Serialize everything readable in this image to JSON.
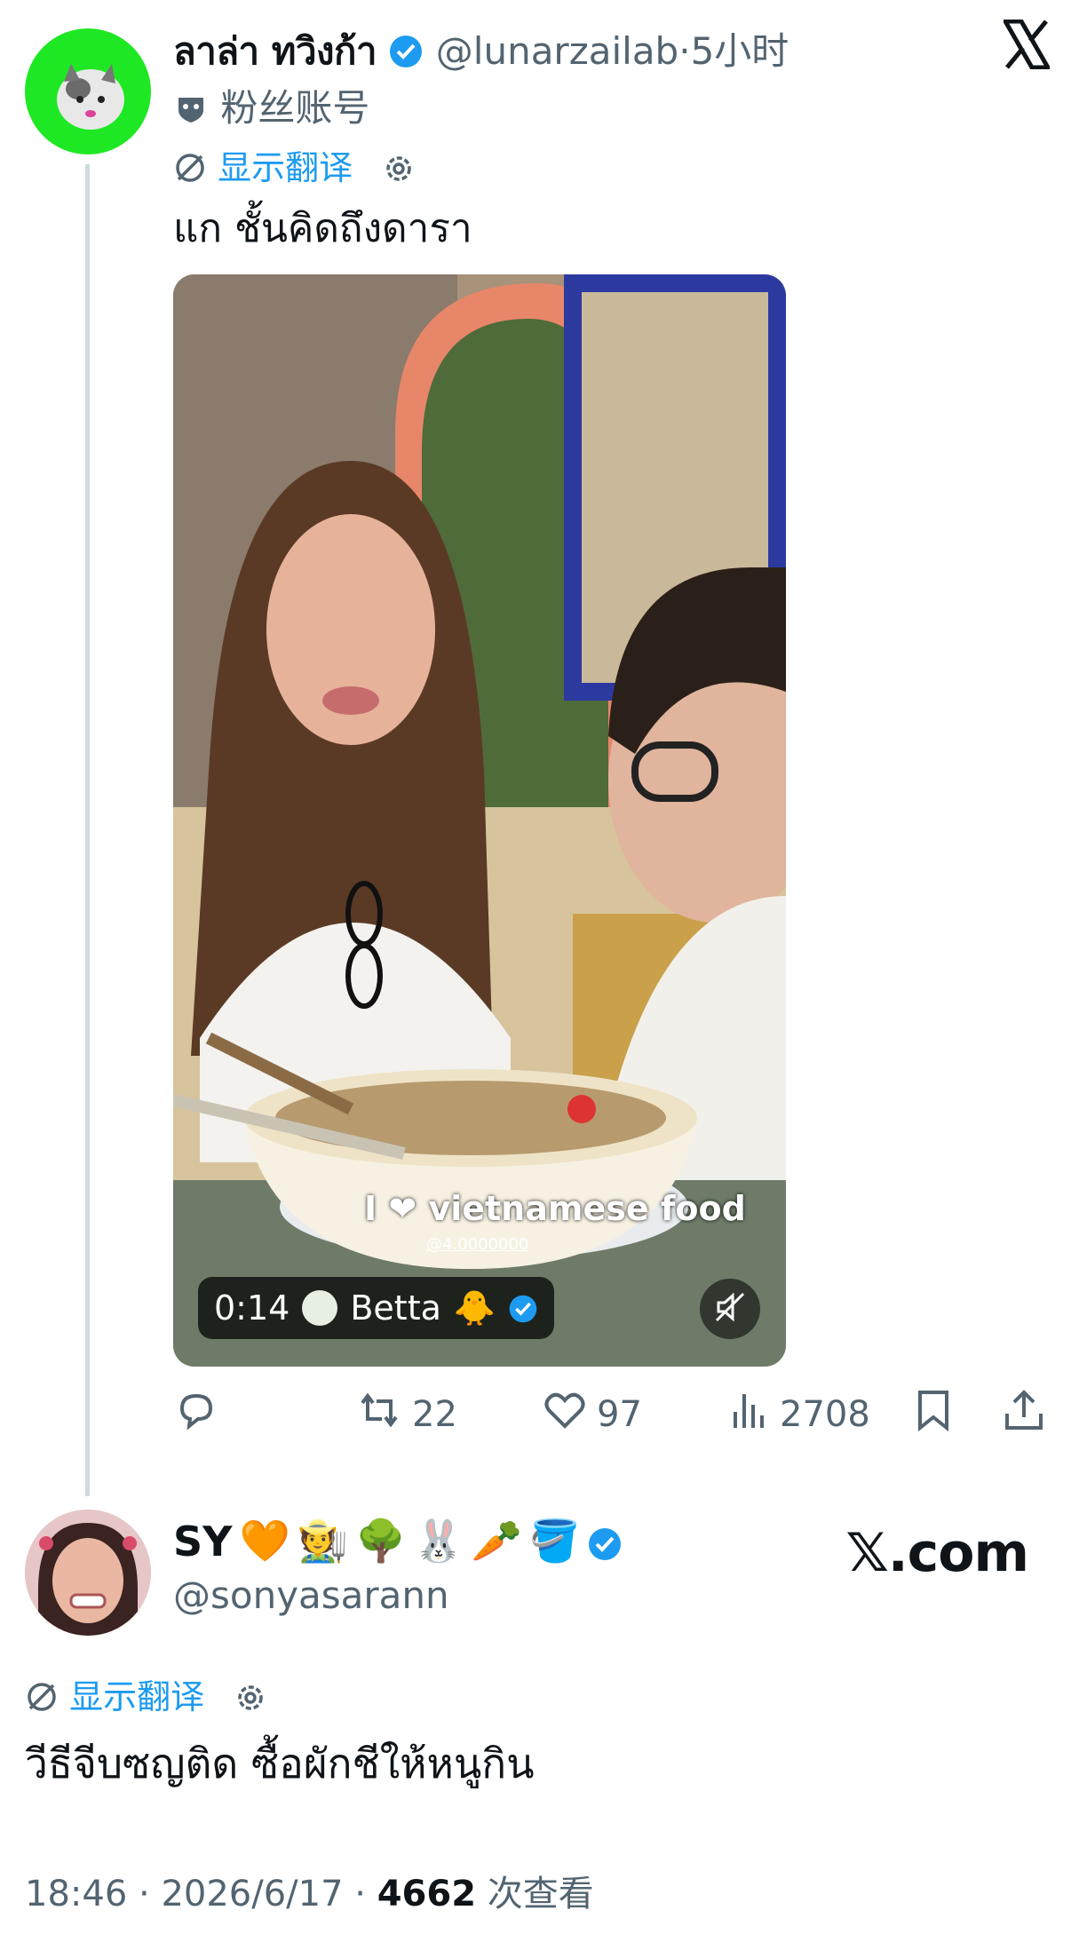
{
  "main_tweet": {
    "display_name": "ลาล่า ทวิงก้า",
    "handle": "@lunarzailab",
    "separator": "·",
    "time_ago": "5小时",
    "fan_label": "粉丝账号",
    "translate_label": "显示翻译",
    "text": "แก ชั้นคิดถึงดารา",
    "media": {
      "overlay_text": "I ❤ vietnamese food",
      "overlay_sub": "@4.0000000",
      "duration": "0:14",
      "creator": "Betta",
      "creator_emoji": "🐥"
    },
    "stats": {
      "retweets": "22",
      "likes": "97",
      "views": "2708"
    }
  },
  "quote_tweet": {
    "display_name": "SY",
    "emojis": [
      "🧡",
      "🧑‍🌾",
      "🌳",
      "🐰",
      "🥕",
      "🪣"
    ],
    "handle": "@sonyasarann",
    "translate_label": "显示翻译",
    "text": "วีธีจีบซญติด ซื้อผักชีให้หนูกิน",
    "time": "18:46",
    "date": "2026/6/17",
    "views": "4662",
    "views_label": "次查看",
    "dot": "·"
  },
  "watermark": "𝕏.com",
  "colors": {
    "accent": "#1d9bf0",
    "muted": "#536471",
    "avatar_bg": "#1ee823"
  },
  "icons": [
    "x-logo-icon",
    "verified-badge-icon",
    "mask-icon",
    "translate-icon",
    "gear-icon",
    "reply-icon",
    "retweet-icon",
    "heart-icon",
    "views-icon",
    "bookmark-icon",
    "share-icon",
    "mute-icon"
  ]
}
